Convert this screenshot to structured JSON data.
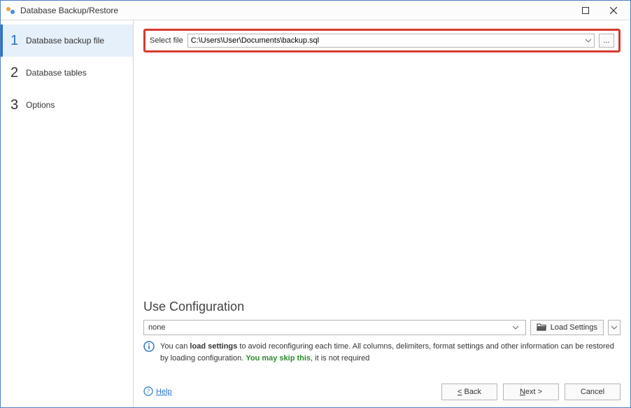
{
  "window": {
    "title": "Database Backup/Restore"
  },
  "sidebar": {
    "steps": [
      {
        "num": "1",
        "label": "Database backup file"
      },
      {
        "num": "2",
        "label": "Database tables"
      },
      {
        "num": "3",
        "label": "Options"
      }
    ]
  },
  "file_row": {
    "label": "Select file",
    "value": "C:\\Users\\User\\Documents\\backup.sql",
    "browse": "..."
  },
  "config": {
    "heading": "Use Configuration",
    "selected": "none",
    "load_label": "Load Settings",
    "info_pre": "You can ",
    "info_bold1": "load settings",
    "info_mid": " to avoid reconfiguring each time. All columns, delimiters, format settings and other information can be restored by loading configuration. ",
    "info_green": "You may skip this",
    "info_post": ", it is not required"
  },
  "footer": {
    "help": "Help",
    "back": "< Back",
    "next": "Next >",
    "cancel": "Cancel"
  }
}
